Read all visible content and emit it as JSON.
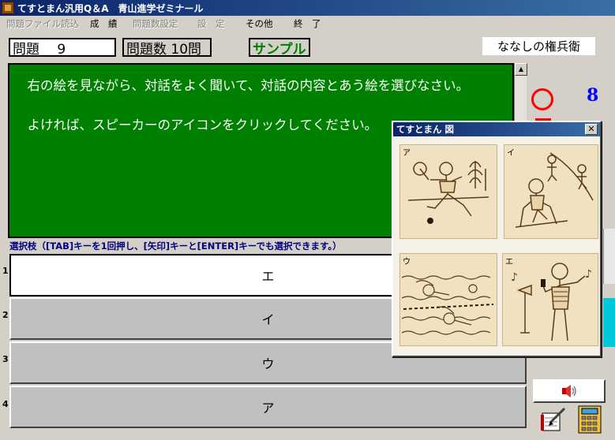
{
  "window": {
    "title": "てすとまん汎用Q＆A　青山進学ゼミナール"
  },
  "menu": [
    {
      "label": "問題ファイル読込",
      "disabled": true
    },
    {
      "label": "成　績",
      "disabled": false
    },
    {
      "label": "問題数設定",
      "disabled": true
    },
    {
      "label": "設　定",
      "disabled": true
    },
    {
      "label": "その他",
      "disabled": false
    },
    {
      "label": "終　了",
      "disabled": false
    }
  ],
  "header": {
    "question_no": "問題　 9",
    "question_count": "問題数 10問",
    "mode": "サンプル",
    "user_name": "ななしの権兵衛"
  },
  "question": {
    "paragraphs": [
      "右の絵を見ながら、対話をよく聞いて、対話の内容とあう絵を選びなさい。",
      "よければ、スピーカーのアイコンをクリックしてください。"
    ]
  },
  "instruction": "選択枝（[TAB]キーを1回押し、[矢印]キーと[ENTER]キーでも選択できます。）",
  "choices": [
    {
      "num": "1",
      "label": "エ",
      "selected": true
    },
    {
      "num": "2",
      "label": "イ",
      "selected": false
    },
    {
      "num": "3",
      "label": "ウ",
      "selected": false
    },
    {
      "num": "4",
      "label": "ア",
      "selected": false
    }
  ],
  "score": {
    "correct_count": "8"
  },
  "figure": {
    "title": "てすとまん 図",
    "pictures": [
      {
        "label": "ア",
        "icon": "tennis-player-illustration"
      },
      {
        "label": "イ",
        "icon": "skier-illustration"
      },
      {
        "label": "ウ",
        "icon": "swimmers-illustration"
      },
      {
        "label": "エ",
        "icon": "singer-illustration"
      }
    ]
  },
  "colors": {
    "question_bg": "#008000",
    "title_bar": "#0a246a",
    "correct_mark": "#ff0000",
    "score": "#0000ff"
  }
}
